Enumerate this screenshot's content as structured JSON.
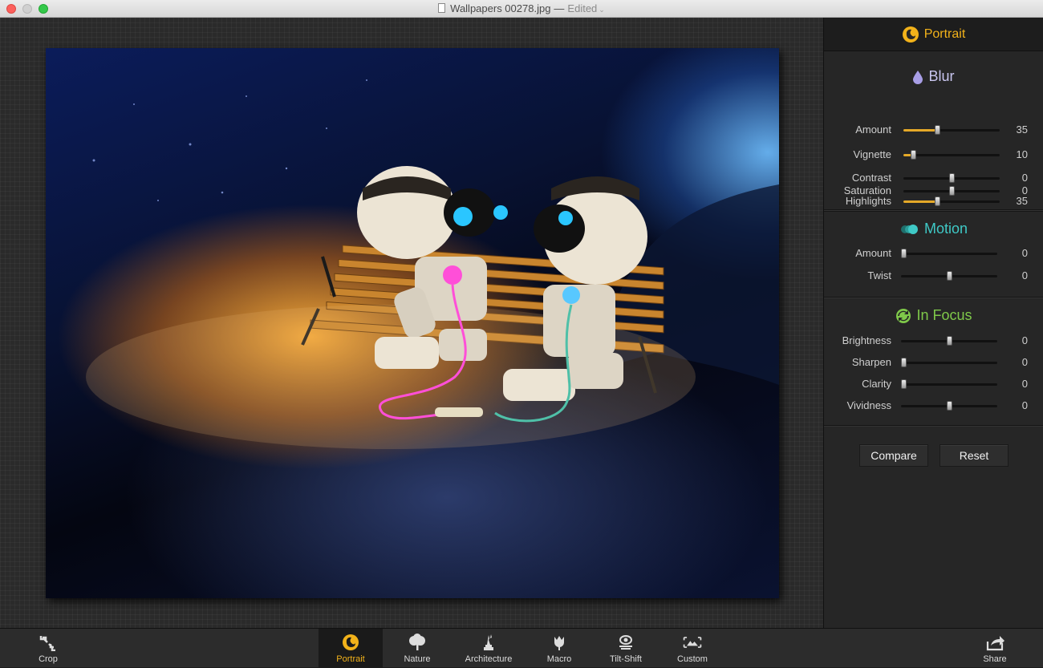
{
  "window": {
    "filename": "Wallpapers 00278.jpg",
    "separator": "—",
    "status": "Edited"
  },
  "panel": {
    "title": "Portrait",
    "sections": {
      "blur": {
        "title": "Blur",
        "color": "#c9c6f0",
        "sliders": [
          {
            "label": "Amount",
            "value": "35",
            "level": 0.35
          },
          {
            "label": "Vignette",
            "value": "10",
            "level": 0.1
          },
          {
            "label": "Contrast",
            "value": "0",
            "level": 0.5
          },
          {
            "label": "Highlights",
            "value": "35",
            "level": 0.35
          },
          {
            "label": "Saturation",
            "value": "0",
            "level": 0.5
          }
        ]
      },
      "motion": {
        "title": "Motion",
        "color": "#3fc9c6",
        "sliders": [
          {
            "label": "Amount",
            "value": "0",
            "level": 0.0
          },
          {
            "label": "Twist",
            "value": "0",
            "level": 0.5
          }
        ]
      },
      "in_focus": {
        "title": "In Focus",
        "color": "#7fc94a",
        "sliders": [
          {
            "label": "Brightness",
            "value": "0",
            "level": 0.5
          },
          {
            "label": "Sharpen",
            "value": "0",
            "level": 0.0
          },
          {
            "label": "Clarity",
            "value": "0",
            "level": 0.0
          },
          {
            "label": "Vividness",
            "value": "0",
            "level": 0.5
          }
        ]
      }
    },
    "buttons": {
      "compare": "Compare",
      "reset": "Reset"
    }
  },
  "toolbar": {
    "crop": "Crop",
    "portrait": "Portrait",
    "nature": "Nature",
    "architecture": "Architecture",
    "macro": "Macro",
    "tilt_shift": "Tilt-Shift",
    "custom": "Custom",
    "share": "Share"
  },
  "colors": {
    "accent": "#f2b21a",
    "slider_fill": "#e5a928"
  }
}
